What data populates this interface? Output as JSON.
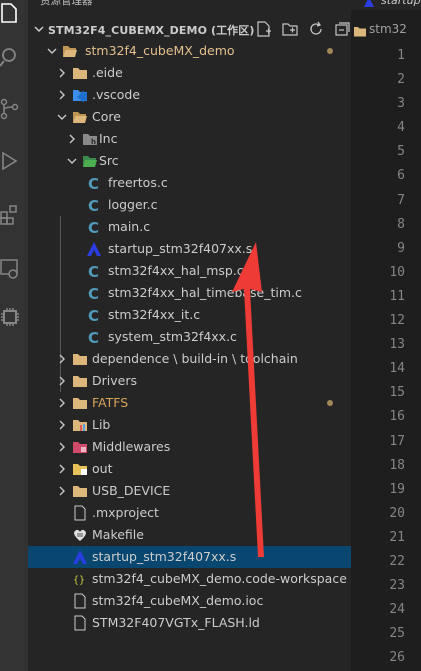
{
  "sidebar": {
    "title": "资源管理器",
    "section_title": "STM32F4_CUBEMX_DEMO (工作区)",
    "actions": [
      "new-file",
      "new-folder",
      "refresh",
      "collapse-all"
    ],
    "items": [
      {
        "label": "stm32f4_cubeMX_demo",
        "depth": 0,
        "kind": "folder-open",
        "chevron": "down",
        "color": "yellow",
        "dot": true
      },
      {
        "label": ".eide",
        "depth": 1,
        "kind": "folder",
        "chevron": "right"
      },
      {
        "label": ".vscode",
        "depth": 1,
        "kind": "vscode-folder",
        "chevron": "right"
      },
      {
        "label": "Core",
        "depth": 1,
        "kind": "folder-open",
        "chevron": "down"
      },
      {
        "label": "Inc",
        "depth": 2,
        "kind": "inc-folder",
        "chevron": "right"
      },
      {
        "label": "Src",
        "depth": 2,
        "kind": "src-folder",
        "chevron": "down"
      },
      {
        "label": "freertos.c",
        "depth": 3,
        "kind": "c-file"
      },
      {
        "label": "logger.c",
        "depth": 3,
        "kind": "c-file"
      },
      {
        "label": "main.c",
        "depth": 3,
        "kind": "c-file"
      },
      {
        "label": "startup_stm32f407xx.s",
        "depth": 3,
        "kind": "asm-file"
      },
      {
        "label": "stm32f4xx_hal_msp.c",
        "depth": 3,
        "kind": "c-file"
      },
      {
        "label": "stm32f4xx_hal_timebase_tim.c",
        "depth": 3,
        "kind": "c-file"
      },
      {
        "label": "stm32f4xx_it.c",
        "depth": 3,
        "kind": "c-file"
      },
      {
        "label": "system_stm32f4xx.c",
        "depth": 3,
        "kind": "c-file"
      },
      {
        "label": "dependence \\ build-in \\ toolchain",
        "depth": 1,
        "kind": "folder",
        "chevron": "right"
      },
      {
        "label": "Drivers",
        "depth": 1,
        "kind": "folder",
        "chevron": "right"
      },
      {
        "label": "FATFS",
        "depth": 1,
        "kind": "folder",
        "chevron": "right",
        "color": "orange",
        "dot": true
      },
      {
        "label": "Lib",
        "depth": 1,
        "kind": "lib-folder",
        "chevron": "right"
      },
      {
        "label": "Middlewares",
        "depth": 1,
        "kind": "mw-folder",
        "chevron": "right"
      },
      {
        "label": "out",
        "depth": 1,
        "kind": "out-folder",
        "chevron": "right"
      },
      {
        "label": "USB_DEVICE",
        "depth": 1,
        "kind": "folder",
        "chevron": "right"
      },
      {
        "label": ".mxproject",
        "depth": 1,
        "kind": "file"
      },
      {
        "label": "Makefile",
        "depth": 1,
        "kind": "makefile"
      },
      {
        "label": "startup_stm32f407xx.s",
        "depth": 1,
        "kind": "asm-file",
        "selected": true
      },
      {
        "label": "stm32f4_cubeMX_demo.code-workspace",
        "depth": 1,
        "kind": "json-file"
      },
      {
        "label": "stm32f4_cubeMX_demo.ioc",
        "depth": 1,
        "kind": "file"
      },
      {
        "label": "STM32F407VGTx_FLASH.ld",
        "depth": 1,
        "kind": "file"
      }
    ]
  },
  "editor": {
    "tab_label": "startup",
    "breadcrumb": "stm32",
    "line_numbers": [
      "1",
      "2",
      "3",
      "4",
      "5",
      "6",
      "7",
      "8",
      "9",
      "10",
      "11",
      "12",
      "13",
      "14",
      "15",
      "16",
      "17",
      "18",
      "19",
      "20",
      "21",
      "22",
      "23",
      "24",
      "25",
      "26"
    ]
  },
  "colors": {
    "folder": "#dcb67a",
    "c_file": "#519aba",
    "asm_file": "#2a3de0",
    "selection": "#094771",
    "arrow": "#ee3b36"
  }
}
